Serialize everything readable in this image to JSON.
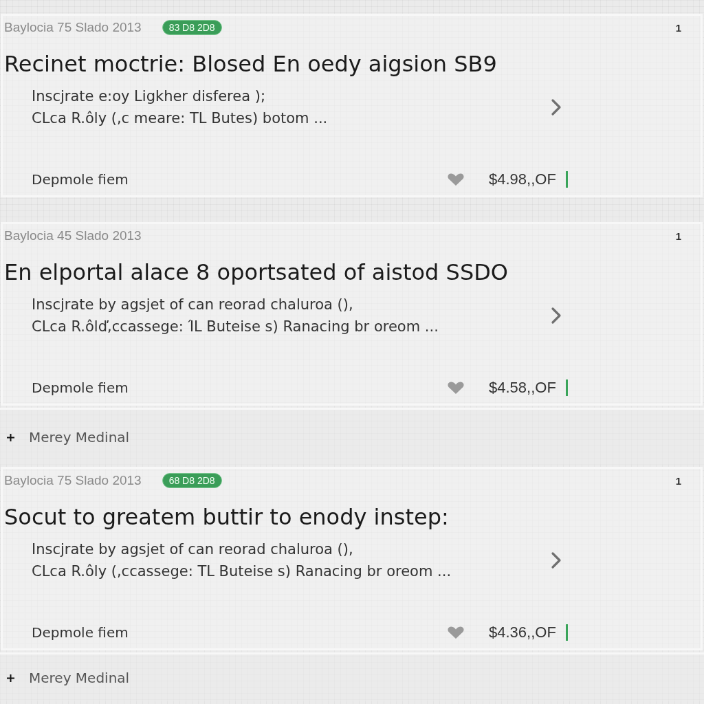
{
  "feed": [
    {
      "kind": "card",
      "meta": "Baylocia 75 Slado 2013",
      "badge": "83 D8 2D8",
      "count": "1",
      "title": "Recinet moctrie:  Blosed En oedy aigsion SB9",
      "description": [
        "Inscjrate e:oy Ligkher disferea );",
        "CLca R.ôly (,c meare: TL Butes) botom ..."
      ],
      "footer_label": "Depmole fiem",
      "price": "$4.98,,OF"
    },
    {
      "kind": "card",
      "meta": "Baylocia 45 Slado 2013",
      "count": "1",
      "title": "En elportal alace 8 oportsated of aistod SSDO",
      "description": [
        "Inscjrate by agsjet of can reorad chaluroa (),",
        "CLca R.ôlď,ccassege: ΊL Buteise s) Ranacing br oreom ..."
      ],
      "footer_label": "Depmole fiem",
      "price": "$4.58,,OF"
    },
    {
      "kind": "add",
      "label": "Merey Medinal"
    },
    {
      "kind": "card",
      "meta": "Baylocia 75 Slado 2013",
      "badge": "68 D8 2D8",
      "count": "1",
      "title": "Socut to greatem buttir to enody instep:",
      "description": [
        "Inscjrate by agsjet of can reorad chaluroa (),",
        "CLca R.ôly (,ccassege: TL Buteise s) Ranacing br oreom ..."
      ],
      "footer_label": "Depmole fiem",
      "price": "$4.36,,OF"
    },
    {
      "kind": "add",
      "label": "Merey Medinal"
    }
  ]
}
